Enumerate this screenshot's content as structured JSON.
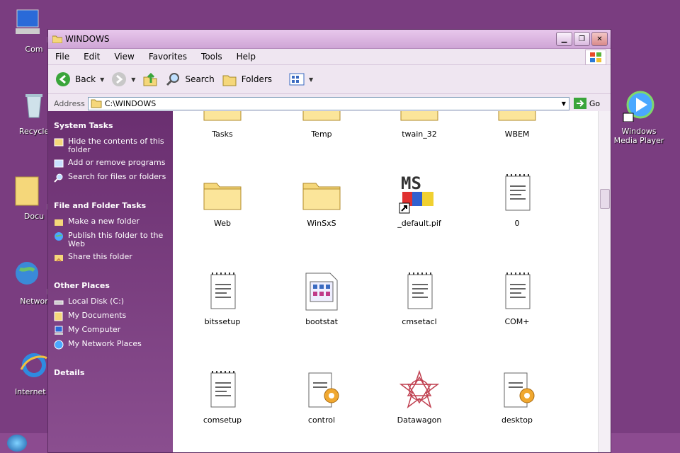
{
  "desktop": {
    "icons": [
      {
        "label": "My Com",
        "icon": "computer-icon"
      },
      {
        "label": "Recycle",
        "icon": "recycle-bin-icon"
      },
      {
        "label": "My Docu",
        "icon": "documents-folder-icon"
      },
      {
        "label": "My Networ",
        "icon": "network-globe-icon"
      },
      {
        "label": "Internet E",
        "icon": "internet-explorer-icon"
      },
      {
        "label": "Windows Media Player",
        "icon": "media-player-icon"
      }
    ]
  },
  "window": {
    "title": "WINDOWS",
    "menu": [
      "File",
      "Edit",
      "View",
      "Favorites",
      "Tools",
      "Help"
    ],
    "toolbar": {
      "back": "Back",
      "search": "Search",
      "folders": "Folders"
    },
    "address": {
      "label": "Address",
      "value": "C:\\WINDOWS",
      "go": "Go"
    }
  },
  "sidepanel": {
    "system_tasks": {
      "header": "System Tasks",
      "items": [
        "Hide the contents of this folder",
        "Add or remove programs",
        "Search for files or folders"
      ]
    },
    "file_folder_tasks": {
      "header": "File and Folder Tasks",
      "items": [
        "Make a new folder",
        "Publish this folder to the Web",
        "Share this folder"
      ]
    },
    "other_places": {
      "header": "Other Places",
      "items": [
        "Local Disk (C:)",
        "My Documents",
        "My Computer",
        "My Network Places"
      ]
    },
    "details": {
      "header": "Details"
    }
  },
  "files": [
    {
      "name": "Tasks",
      "type": "folder"
    },
    {
      "name": "Temp",
      "type": "folder"
    },
    {
      "name": "twain_32",
      "type": "folder"
    },
    {
      "name": "WBEM",
      "type": "folder"
    },
    {
      "name": "Web",
      "type": "folder"
    },
    {
      "name": "WinSxS",
      "type": "folder"
    },
    {
      "name": "_default.pif",
      "type": "msdos-shortcut"
    },
    {
      "name": "0",
      "type": "text"
    },
    {
      "name": "bitssetup",
      "type": "text"
    },
    {
      "name": "bootstat",
      "type": "dat"
    },
    {
      "name": "cmsetacl",
      "type": "text"
    },
    {
      "name": "COM+",
      "type": "text"
    },
    {
      "name": "comsetup",
      "type": "text"
    },
    {
      "name": "control",
      "type": "config"
    },
    {
      "name": "Datawagon",
      "type": "star"
    },
    {
      "name": "desktop",
      "type": "config"
    }
  ],
  "colors": {
    "desktop": "#7a3d80",
    "sidepanel": "#6a2f70",
    "folder": "#f5d77a"
  }
}
